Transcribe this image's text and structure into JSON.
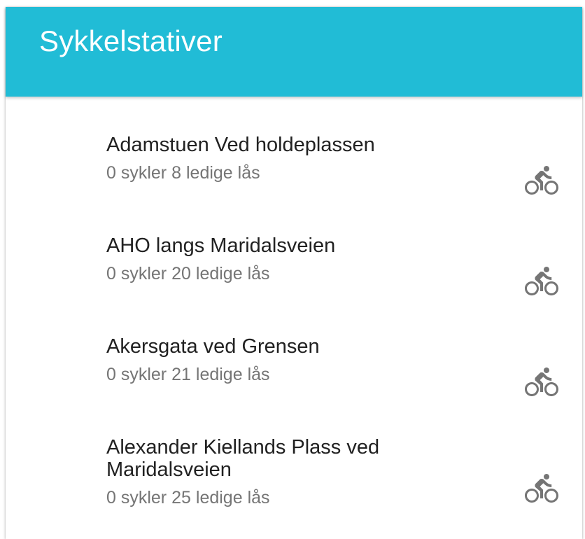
{
  "app": {
    "title": "Sykkelstativer"
  },
  "stations": [
    {
      "name": "Adamstuen Ved holdeplassen",
      "bikes": "0 sykler",
      "locks": "8 ledige lås",
      "icon": "bike-icon"
    },
    {
      "name": "AHO langs Maridalsveien",
      "bikes": "0 sykler",
      "locks": "20 ledige lås",
      "icon": "bike-icon"
    },
    {
      "name": "Akersgata ved Grensen",
      "bikes": "0 sykler",
      "locks": "21 ledige lås",
      "icon": "bike-icon"
    },
    {
      "name": "Alexander Kiellands Plass ved Maridalsveien",
      "bikes": "0 sykler",
      "locks": "25 ledige lås",
      "icon": "bike-icon"
    }
  ],
  "colors": {
    "app_bar": "#21bcd6",
    "title_text": "#ffffff",
    "primary_text": "#212121",
    "secondary_text": "#757575",
    "icon": "#757575"
  }
}
